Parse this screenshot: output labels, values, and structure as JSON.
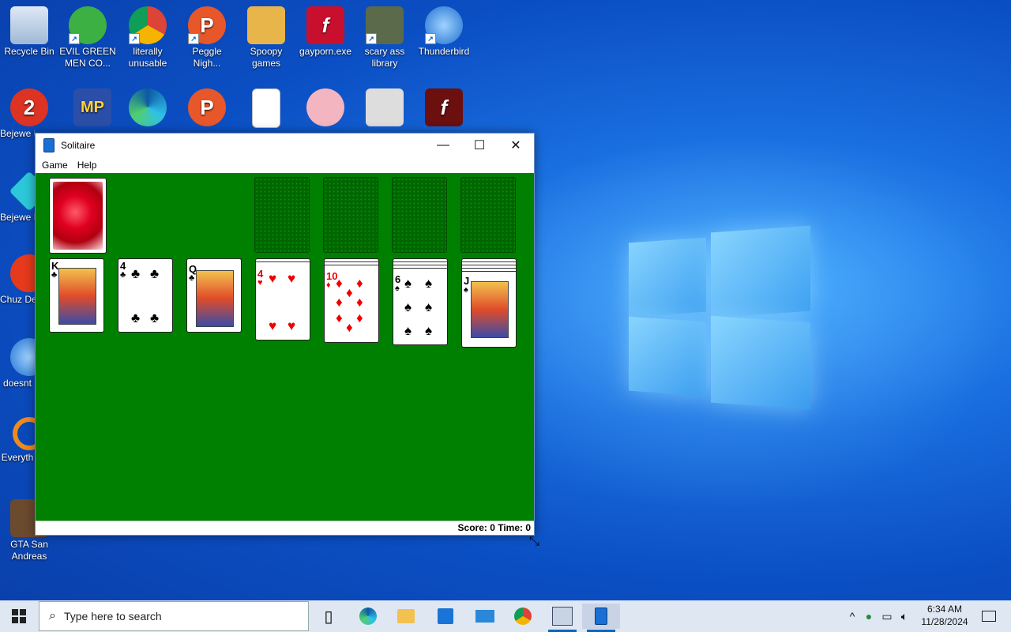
{
  "desktop": {
    "icons": [
      {
        "label": "Recycle Bin",
        "icon": "recycle-bin-icon"
      },
      {
        "label": "EVIL GREEN MEN CO...",
        "icon": "green-people-icon"
      },
      {
        "label": "literally unusable",
        "icon": "chrome-icon"
      },
      {
        "label": "Peggle Nigh...",
        "icon": "peggle-icon"
      },
      {
        "label": "Spoopy games",
        "icon": "folder-icon"
      },
      {
        "label": "gayporn.exe",
        "icon": "flash-icon"
      },
      {
        "label": "scary ass library",
        "icon": "library-icon"
      },
      {
        "label": "Thunderbird",
        "icon": "thunderbird-icon"
      },
      {
        "label": "Bejewe Delu",
        "icon": "bejeweled2-icon"
      },
      {
        "label": "Bejewe Delu",
        "icon": "bejeweled-icon"
      },
      {
        "label": "Chuz Delu",
        "icon": "chuzzle-icon"
      },
      {
        "label": "doesnt",
        "icon": "thunderbird-icon"
      },
      {
        "label": "Everyth",
        "icon": "everything-search-icon"
      },
      {
        "label": "GTA San Andreas",
        "icon": "gta-icon"
      }
    ]
  },
  "window": {
    "title": "Solitaire",
    "minimize": "—",
    "maximize": "☐",
    "close": "✕",
    "menu": [
      "Game",
      "Help"
    ],
    "status": "Score: 0 Time: 0"
  },
  "cards": [
    {
      "rank": "K",
      "suit": "♣",
      "color": "black"
    },
    {
      "rank": "4",
      "suit": "♣",
      "color": "black"
    },
    {
      "rank": "Q",
      "suit": "♣",
      "color": "black"
    },
    {
      "rank": "4",
      "suit": "♥",
      "color": "red"
    },
    {
      "rank": "10",
      "suit": "♦",
      "color": "red"
    },
    {
      "rank": "6",
      "suit": "♠",
      "color": "black"
    },
    {
      "rank": "J",
      "suit": "♠",
      "color": "black"
    }
  ],
  "taskbar": {
    "search_placeholder": "Type here to search",
    "time": "6:34 AM",
    "date": "11/28/2024"
  }
}
